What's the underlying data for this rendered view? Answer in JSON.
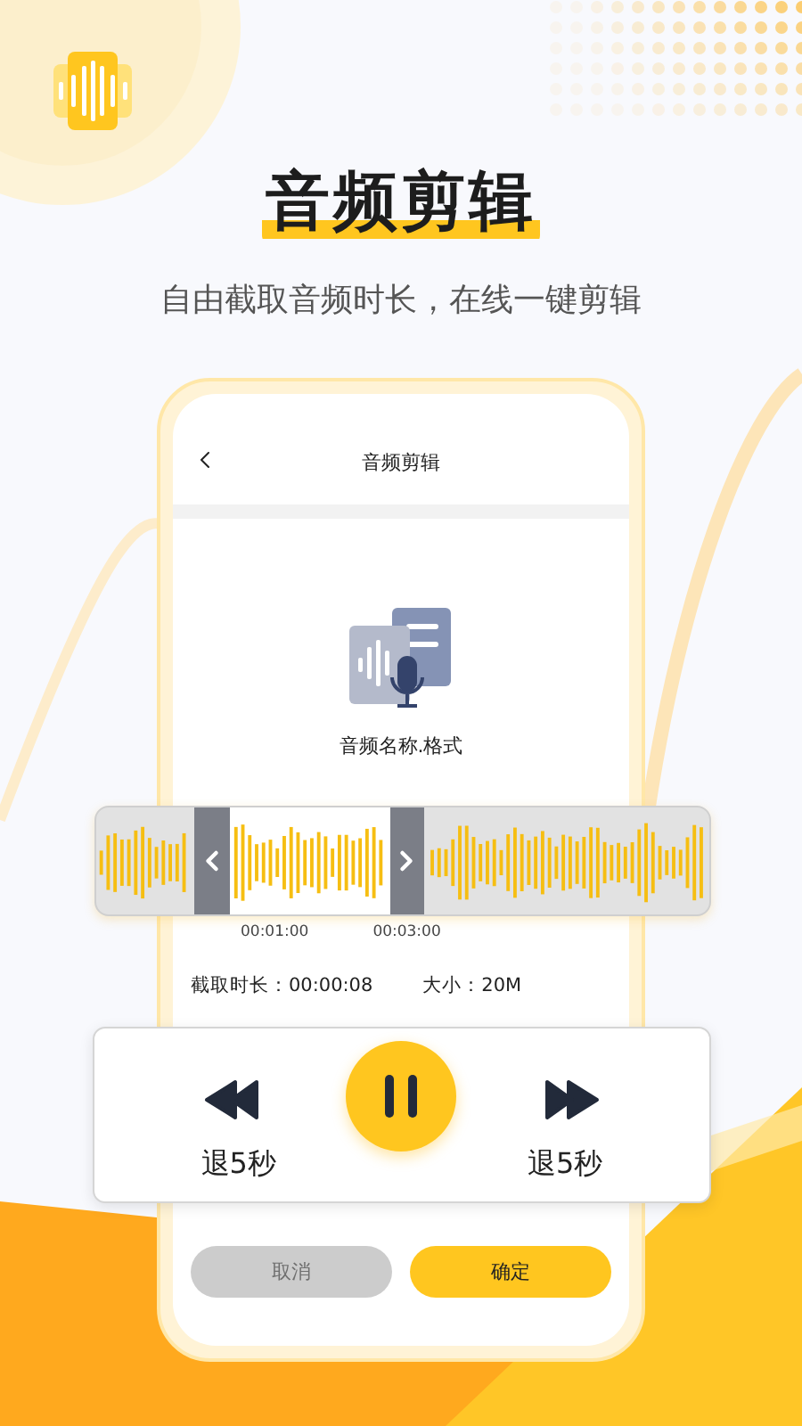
{
  "headline": "音频剪辑",
  "subtitle": "自由截取音频时长，在线一键剪辑",
  "screen": {
    "nav_title": "音频剪辑",
    "file_name": "音频名称.格式",
    "trim_marks": [
      "00:01:00",
      "00:03:00"
    ],
    "duration": "截取时长：00:00:08",
    "size": "大小：20M",
    "controls": [
      {
        "kind": "rewind",
        "label": "退5秒"
      },
      {
        "kind": "pause"
      },
      {
        "kind": "forward",
        "label": "退5秒"
      }
    ],
    "buttons": [
      {
        "label": "取消",
        "disabled": true
      },
      {
        "label": "确定",
        "disabled": false
      }
    ]
  }
}
